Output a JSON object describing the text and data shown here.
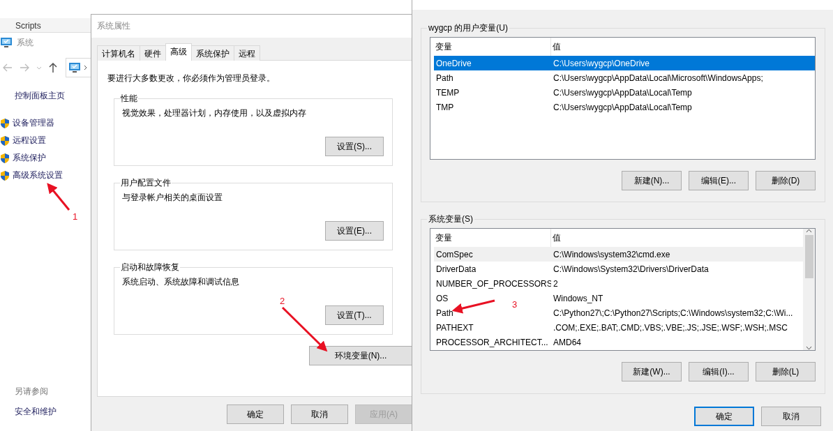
{
  "back_window": {
    "title": "Scripts"
  },
  "explorer": {
    "title": "系统",
    "sidebar": {
      "home": "控制面板主页",
      "items": [
        {
          "label": "设备管理器"
        },
        {
          "label": "远程设置"
        },
        {
          "label": "系统保护"
        },
        {
          "label": "高级系统设置"
        }
      ],
      "see_also": "另请参阅",
      "links": [
        "安全和维护"
      ]
    }
  },
  "system_properties": {
    "title": "系统属性",
    "tabs": [
      {
        "label": "计算机名",
        "selected": false
      },
      {
        "label": "硬件",
        "selected": false
      },
      {
        "label": "高级",
        "selected": true
      },
      {
        "label": "系统保护",
        "selected": false
      },
      {
        "label": "远程",
        "selected": false
      }
    ],
    "notice": "要进行大多数更改，你必须作为管理员登录。",
    "groups": [
      {
        "title": "性能",
        "description": "视觉效果，处理器计划，内存使用，以及虚拟内存",
        "button": "设置(S)..."
      },
      {
        "title": "用户配置文件",
        "description": "与登录帐户相关的桌面设置",
        "button": "设置(E)..."
      },
      {
        "title": "启动和故障恢复",
        "description": "系统启动、系统故障和调试信息",
        "button": "设置(T)..."
      }
    ],
    "env_button": "环境变量(N)...",
    "buttons": [
      {
        "label": "确定",
        "disabled": false
      },
      {
        "label": "取消",
        "disabled": false
      },
      {
        "label": "应用(A)",
        "disabled": true
      }
    ]
  },
  "environment_variables": {
    "user_vars": {
      "title": "wygcp 的用户变量(U)",
      "columns": [
        "变量",
        "值"
      ],
      "rows": [
        {
          "name": "OneDrive",
          "value": "C:\\Users\\wygcp\\OneDrive",
          "selected": true,
          "highlighted": false
        },
        {
          "name": "Path",
          "value": "C:\\Users\\wygcp\\AppData\\Local\\Microsoft\\WindowsApps;",
          "selected": false,
          "highlighted": false
        },
        {
          "name": "TEMP",
          "value": "C:\\Users\\wygcp\\AppData\\Local\\Temp",
          "selected": false,
          "highlighted": false
        },
        {
          "name": "TMP",
          "value": "C:\\Users\\wygcp\\AppData\\Local\\Temp",
          "selected": false,
          "highlighted": false
        }
      ],
      "buttons": [
        "新建(N)...",
        "编辑(E)...",
        "删除(D)"
      ]
    },
    "system_vars": {
      "title": "系统变量(S)",
      "columns": [
        "变量",
        "值"
      ],
      "rows": [
        {
          "name": "ComSpec",
          "value": "C:\\Windows\\system32\\cmd.exe",
          "selected": false,
          "highlighted": true
        },
        {
          "name": "DriverData",
          "value": "C:\\Windows\\System32\\Drivers\\DriverData",
          "selected": false,
          "highlighted": false
        },
        {
          "name": "NUMBER_OF_PROCESSORS",
          "value": "2",
          "selected": false,
          "highlighted": false
        },
        {
          "name": "OS",
          "value": "Windows_NT",
          "selected": false,
          "highlighted": false
        },
        {
          "name": "Path",
          "value": "C:\\Python27\\;C:\\Python27\\Scripts;C:\\Windows\\system32;C:\\Wi...",
          "selected": false,
          "highlighted": false
        },
        {
          "name": "PATHEXT",
          "value": ".COM;.EXE;.BAT;.CMD;.VBS;.VBE;.JS;.JSE;.WSF;.WSH;.MSC",
          "selected": false,
          "highlighted": false
        },
        {
          "name": "PROCESSOR_ARCHITECT...",
          "value": "AMD64",
          "selected": false,
          "highlighted": false
        }
      ],
      "buttons": [
        "新建(W)...",
        "编辑(I)...",
        "删除(L)"
      ]
    },
    "buttons": [
      {
        "label": "确定",
        "default": true
      },
      {
        "label": "取消",
        "default": false
      }
    ]
  },
  "annotations": [
    {
      "label": "1"
    },
    {
      "label": "2"
    },
    {
      "label": "3"
    }
  ]
}
